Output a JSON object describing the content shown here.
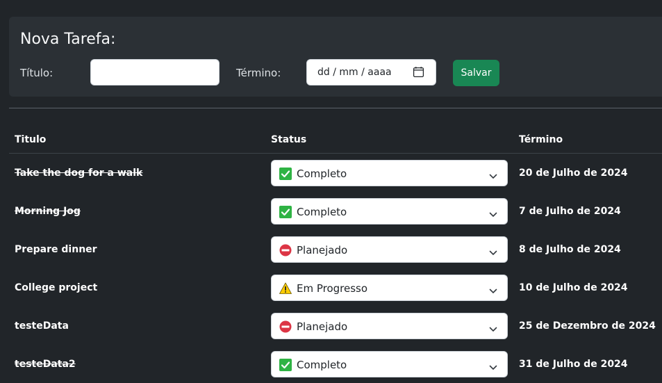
{
  "form": {
    "title": "Nova Tarefa:",
    "titulo_label": "Título:",
    "titulo_value": "",
    "termino_label": "Término:",
    "date_placeholder": "dd / mm / aaaa",
    "save_label": "Salvar"
  },
  "table": {
    "headers": {
      "titulo": "Titulo",
      "status": "Status",
      "termino": "Término"
    },
    "rows": [
      {
        "title": "Take the dog for a walk",
        "done": true,
        "status": "Completo",
        "status_icon": "check-icon",
        "date": "20 de Julho de 2024"
      },
      {
        "title": "Morning Jog",
        "done": true,
        "status": "Completo",
        "status_icon": "check-icon",
        "date": "7 de Julho de 2024"
      },
      {
        "title": "Prepare dinner",
        "done": false,
        "status": "Planejado",
        "status_icon": "no-entry-icon",
        "date": "8 de Julho de 2024"
      },
      {
        "title": "College project",
        "done": false,
        "status": "Em Progresso",
        "status_icon": "warning-icon",
        "date": "10 de Julho de 2024"
      },
      {
        "title": "testeData",
        "done": false,
        "status": "Planejado",
        "status_icon": "no-entry-icon",
        "date": "25 de Dezembro de 2024"
      },
      {
        "title": "testeData2",
        "done": true,
        "status": "Completo",
        "status_icon": "check-icon",
        "date": "31 de Julho de 2024"
      }
    ]
  },
  "colors": {
    "background": "#212529",
    "panel": "#2b3035",
    "accent_save": "#198754",
    "check_green": "#2fb344",
    "no_entry_red": "#dc3545",
    "warning_yellow": "#ffcc00"
  }
}
